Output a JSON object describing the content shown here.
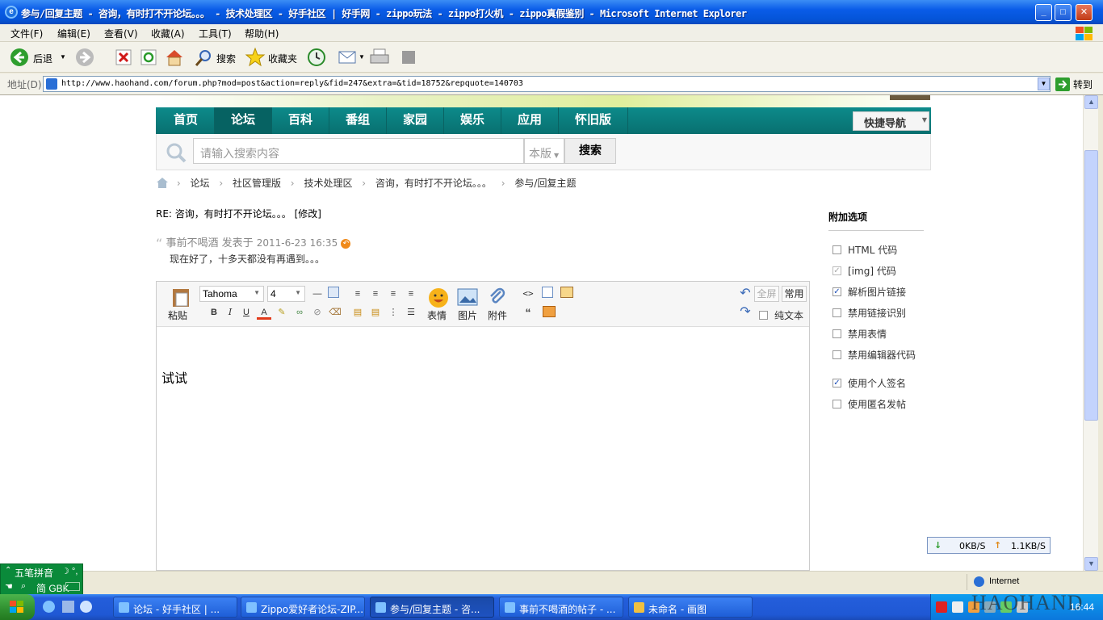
{
  "window": {
    "title": "参与/回复主题 - 咨询，有时打不开论坛。。。 - 技术处理区 - 好手社区 | 好手网 - zippo玩法 - zippo打火机 - zippo真假鉴别 - Microsoft Internet Explorer",
    "min": "_",
    "max": "□",
    "close": "✕"
  },
  "menu": [
    "文件(F)",
    "编辑(E)",
    "查看(V)",
    "收藏(A)",
    "工具(T)",
    "帮助(H)"
  ],
  "toolbar": {
    "back": "后退",
    "search": "搜索",
    "favorites": "收藏夹"
  },
  "address": {
    "label": "地址(D)",
    "url": "http://www.haohand.com/forum.php?mod=post&action=reply&fid=247&extra=&tid=18752&repquote=140703",
    "go": "转到"
  },
  "site_nav": [
    "首页",
    "论坛",
    "百科",
    "番组",
    "家园",
    "娱乐",
    "应用",
    "怀旧版"
  ],
  "quick_nav": "快捷导航",
  "search": {
    "placeholder": "请输入搜索内容",
    "scope": "本版",
    "button": "搜索"
  },
  "breadcrumb": [
    "论坛",
    "社区管理版",
    "技术处理区",
    "咨询，有时打不开论坛。。。",
    "参与/回复主题"
  ],
  "post": {
    "title": "RE: 咨询，有时打不开论坛。。。 [修改]",
    "quote_author": "事前不喝酒 发表于 ",
    "quote_time": "2011-6-23 16:35",
    "quote_text": "现在好了，十多天都没有再遇到。。。"
  },
  "editor": {
    "paste": "粘贴",
    "font": "Tahoma",
    "size": "4",
    "emoji": "表情",
    "image": "图片",
    "attach": "附件",
    "fullscreen": "全屏",
    "common": "常用",
    "plaintext": "纯文本",
    "content": "试试"
  },
  "options": {
    "title": "附加选项",
    "items": [
      {
        "label": "HTML 代码",
        "checked": false
      },
      {
        "label": "[img] 代码",
        "checked": true
      },
      {
        "label": "解析图片链接",
        "checked": true
      },
      {
        "label": "禁用链接识别",
        "checked": false
      },
      {
        "label": "禁用表情",
        "checked": false
      },
      {
        "label": "禁用编辑器代码",
        "checked": false
      },
      {
        "label": "使用个人签名",
        "checked": true
      },
      {
        "label": "使用匿名发帖",
        "checked": false
      }
    ]
  },
  "netmeter": {
    "down": "0KB/S",
    "up": "1.1KB/S"
  },
  "status": {
    "zone": "Internet"
  },
  "ime": {
    "name": "五笔拼音",
    "mode": "简 GBK"
  },
  "taskbar": {
    "tasks": [
      "论坛 - 好手社区 | ...",
      "Zippo爱好者论坛-ZIP...",
      "参与/回复主题 - 咨...",
      "事前不喝酒的帖子 - ...",
      "未命名 - 画图"
    ],
    "clock": "16:44",
    "watermark": "HAOHAND"
  },
  "colors": {
    "nav": "#0d8a8a",
    "xp_blue": "#245edb",
    "ime_green": "#0a8a3a"
  }
}
